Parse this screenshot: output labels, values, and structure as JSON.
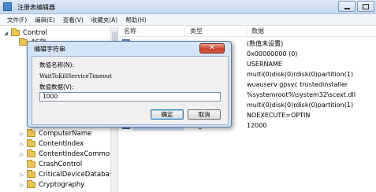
{
  "window": {
    "title": "注册表编辑器"
  },
  "menu": [
    "文件(F)",
    "编辑(E)",
    "查看(V)",
    "收藏夹(A)",
    "帮助(H)"
  ],
  "tree": {
    "top_items": [
      "Control",
      "ACPI"
    ],
    "bottom_items": [
      "ComputerName",
      "ContentIndex",
      "ContentIndexCommon",
      "CrashControl",
      "CriticalDeviceDatabase",
      "Cryptography"
    ]
  },
  "list": {
    "headers": {
      "name": "名称",
      "type": "类型",
      "data": "数据"
    },
    "rows": [
      {
        "name": "",
        "type": "REG_SZ",
        "data": "(数值未设置)"
      },
      {
        "name": "",
        "type": "",
        "data": "0x00000000 (0)"
      },
      {
        "name": "",
        "type": "",
        "data": "USERNAME"
      },
      {
        "name": "",
        "type": "",
        "data": "multi(0)disk(0)rdisk(0)partition(1)"
      },
      {
        "name": "",
        "type": "",
        "data": "wuauserv gpsvc trustedinstaller"
      },
      {
        "name": "",
        "type": "",
        "data": "%systemroot%\\system32\\scext.dll"
      },
      {
        "name": "",
        "type": "",
        "data": "multi(0)disk(0)rdisk(0)partition(1)"
      },
      {
        "name": "",
        "type": "",
        "data": " NOEXECUTE=OPTIN"
      },
      {
        "name": "WaitToKillServi...",
        "type": "REG_SZ",
        "data": "12000"
      }
    ]
  },
  "dialog": {
    "title": "编辑字符串",
    "value_name_label": "数值名称(N):",
    "value_name": "WaitToKillServiceTimeout",
    "value_data_label": "数值数据(V):",
    "value_data": "1000",
    "ok_label": "确定",
    "cancel_label": "取消",
    "close_glyph": "✕"
  }
}
